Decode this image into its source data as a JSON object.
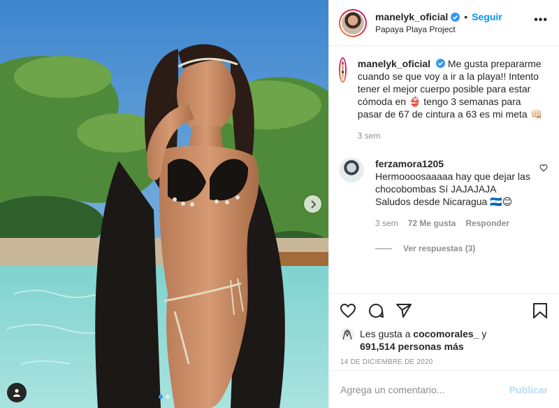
{
  "post": {
    "username": "manelyk_oficial",
    "verified_icon": "verified-badge-icon",
    "separator": "•",
    "follow_label": "Seguir",
    "location": "Papaya Playa Project",
    "more_label": "•••"
  },
  "caption": {
    "username": "manelyk_oficial",
    "text": "Me gusta prepararme cuando se que voy a ir a la playa!! Intento tener el mejor cuerpo posible para estar cómoda en 👙 tengo 3 semanas para pasar de 67 de cintura a 63 es mi meta 👊🏻",
    "age": "3 sem"
  },
  "comment": {
    "username": "ferzamora1205",
    "text": "Hermoooosaaaaa hay que dejar las chocobombas Sí JAJAJAJA Saludos desde Nicaragua 🇳🇮😊",
    "emoji_tail": "😊",
    "age": "3 sem",
    "likes": "72 Me gusta",
    "reply_label": "Responder",
    "view_replies": "Ver respuestas (3)"
  },
  "likes": {
    "prefix": "Les gusta a",
    "user": "cocomorales_",
    "connector": "y",
    "count": "691,514 personas más"
  },
  "date": "14 DE DICIEMBRE DE 2020",
  "add_comment": {
    "placeholder": "Agrega un comentario...",
    "publish_label": "Publicar"
  },
  "carousel": {
    "current": 1,
    "total": 2
  },
  "colors": {
    "accent": "#0095f6",
    "publish_disabled": "#b2dffc",
    "verified": "#3897f0"
  },
  "icons": [
    "heart-icon",
    "comment-icon",
    "share-icon",
    "bookmark-icon",
    "chevron-right-icon",
    "user-tag-icon",
    "more-options-icon"
  ]
}
